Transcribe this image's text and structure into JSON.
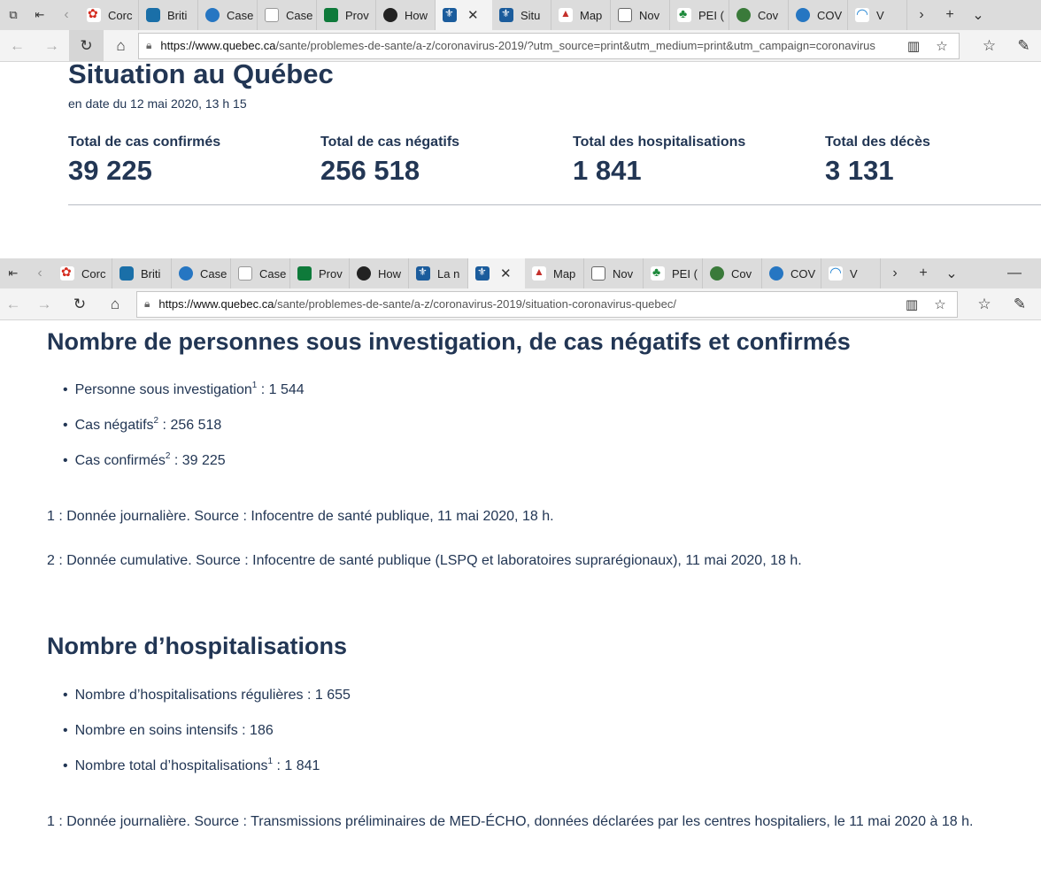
{
  "browser1": {
    "tabs": [
      {
        "label": "Corc",
        "favicon": "canada-flag-icon"
      },
      {
        "label": "Briti",
        "favicon": "bc-icon"
      },
      {
        "label": "Case",
        "favicon": "blue-logo-icon"
      },
      {
        "label": "Case",
        "favicon": "yellow-logo-icon"
      },
      {
        "label": "Prov",
        "favicon": "green-logo-icon"
      },
      {
        "label": "How",
        "favicon": "dark-logo-icon"
      },
      {
        "label": "",
        "favicon": "quebec-fleur-icon",
        "active": true
      },
      {
        "label": "Situ",
        "favicon": "quebec-fleur-icon"
      },
      {
        "label": "Map",
        "favicon": "red-logo-icon"
      },
      {
        "label": "Nov",
        "favicon": "news-icon"
      },
      {
        "label": "PEI (",
        "favicon": "pei-icon"
      },
      {
        "label": "Cov",
        "favicon": "globe-icon"
      },
      {
        "label": "COV",
        "favicon": "nl-icon"
      },
      {
        "label": "V",
        "favicon": "wave-icon"
      }
    ],
    "url_host": "https://www.quebec.ca",
    "url_path": "/sante/problemes-de-sante/a-z/coronavirus-2019/?utm_source=print&utm_medium=print&utm_campaign=coronavirus"
  },
  "browser2": {
    "tabs": [
      {
        "label": "Corc",
        "favicon": "canada-flag-icon"
      },
      {
        "label": "Briti",
        "favicon": "bc-icon"
      },
      {
        "label": "Case",
        "favicon": "blue-logo-icon"
      },
      {
        "label": "Case",
        "favicon": "yellow-logo-icon"
      },
      {
        "label": "Prov",
        "favicon": "green-logo-icon"
      },
      {
        "label": "How",
        "favicon": "dark-logo-icon"
      },
      {
        "label": "La n",
        "favicon": "quebec-fleur-icon"
      },
      {
        "label": "",
        "favicon": "quebec-fleur-icon",
        "active": true
      },
      {
        "label": "Map",
        "favicon": "red-logo-icon"
      },
      {
        "label": "Nov",
        "favicon": "news-icon"
      },
      {
        "label": "PEI (",
        "favicon": "pei-icon"
      },
      {
        "label": "Cov",
        "favicon": "globe-icon"
      },
      {
        "label": "COV",
        "favicon": "nl-icon"
      },
      {
        "label": "V",
        "favicon": "wave-icon"
      }
    ],
    "url_host": "https://www.quebec.ca",
    "url_path": "/sante/problemes-de-sante/a-z/coronavirus-2019/situation-coronavirus-quebec/"
  },
  "situation": {
    "title": "Situation au Québec",
    "date": "en date du 12 mai 2020, 13 h 15",
    "stats": [
      {
        "label": "Total de cas confirmés",
        "value": "39 225"
      },
      {
        "label": "Total de cas négatifs",
        "value": "256 518"
      },
      {
        "label": "Total des hospitalisations",
        "value": "1 841"
      },
      {
        "label": "Total des décès",
        "value": "3 131"
      }
    ]
  },
  "investigation": {
    "heading": "Nombre de personnes sous investigation, de cas négatifs et confirmés",
    "items": [
      {
        "label": "Personne sous investigation",
        "sup": "1",
        "value": " : 1 544"
      },
      {
        "label": "Cas négatifs",
        "sup": "2",
        "value": " : 256 518"
      },
      {
        "label": "Cas confirmés",
        "sup": "2",
        "value": " : 39 225"
      }
    ],
    "note1": "1 : Donnée journalière. Source : Infocentre de santé publique, 11 mai 2020, 18 h.",
    "note2": "2 : Donnée cumulative. Source : Infocentre de santé publique (LSPQ et laboratoires suprarégionaux), 11 mai 2020, 18 h."
  },
  "hospitalisations": {
    "heading": "Nombre d’hospitalisations",
    "items": [
      {
        "label": "Nombre d’hospitalisations régulières",
        "sup": "",
        "value": " : 1 655"
      },
      {
        "label": "Nombre en soins intensifs",
        "sup": "",
        "value": " : 186"
      },
      {
        "label": "Nombre total d’hospitalisations",
        "sup": "1",
        "value": " : 1 841"
      }
    ],
    "note1": "1 : Donnée journalière. Source : Transmissions préliminaires de MED-ÉCHO, données déclarées par les centres hospitaliers, le 11 mai 2020 à 18 h."
  }
}
